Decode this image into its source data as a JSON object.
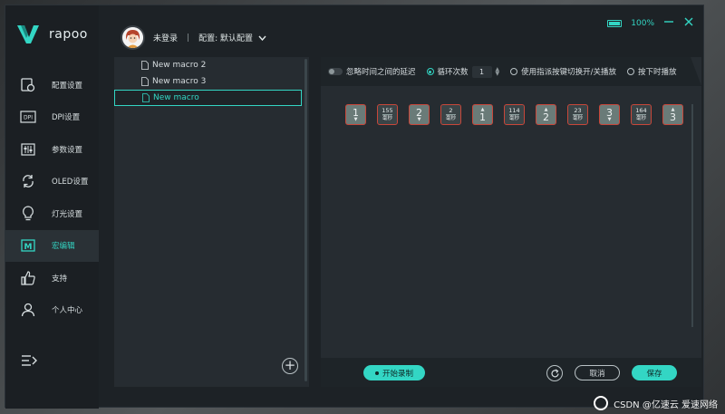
{
  "app": {
    "logo_text": "rapoo",
    "user_status": "未登录",
    "separator": "|",
    "config_label": "配置: 默认配置",
    "battery_pct": "100%"
  },
  "sidebar": {
    "items": [
      {
        "label": "配置设置",
        "icon": "config-icon"
      },
      {
        "label": "DPI设置",
        "icon": "dpi-icon"
      },
      {
        "label": "参数设置",
        "icon": "sliders-icon"
      },
      {
        "label": "OLED设置",
        "icon": "refresh-icon"
      },
      {
        "label": "灯光设置",
        "icon": "bulb-icon"
      },
      {
        "label": "宏编辑",
        "icon": "macro-icon",
        "active": true
      },
      {
        "label": "支持",
        "icon": "thumbs-up-icon"
      },
      {
        "label": "个人中心",
        "icon": "user-icon"
      }
    ]
  },
  "macros": {
    "items": [
      {
        "name": "New macro 2"
      },
      {
        "name": "New macro 3"
      },
      {
        "name": "New macro",
        "active": true
      }
    ],
    "add_symbol": "+"
  },
  "editor": {
    "ignore_delay_label": "忽略时间之间的延迟",
    "loop_label": "循环次数",
    "loop_value": "1",
    "toggle_assign_label": "使用指派按键切换开/关播放",
    "press_play_label": "按下时播放",
    "delay_unit": "毫秒",
    "events": [
      {
        "type": "key",
        "key": "1",
        "dir": "down"
      },
      {
        "type": "delay",
        "ms": "155"
      },
      {
        "type": "key",
        "key": "2",
        "dir": "down"
      },
      {
        "type": "delay",
        "ms": "2"
      },
      {
        "type": "key",
        "key": "1",
        "dir": "up"
      },
      {
        "type": "delay",
        "ms": "114"
      },
      {
        "type": "key",
        "key": "2",
        "dir": "up"
      },
      {
        "type": "delay",
        "ms": "23"
      },
      {
        "type": "key",
        "key": "3",
        "dir": "down"
      },
      {
        "type": "delay",
        "ms": "164"
      },
      {
        "type": "key",
        "key": "3",
        "dir": "up"
      }
    ],
    "record_label": "开始录制",
    "cancel_label": "取消",
    "save_label": "保存"
  },
  "watermark": "CSDN @亿速云 爱速网络",
  "colors": {
    "accent": "#33d6c4",
    "key_border": "#c8473a"
  }
}
